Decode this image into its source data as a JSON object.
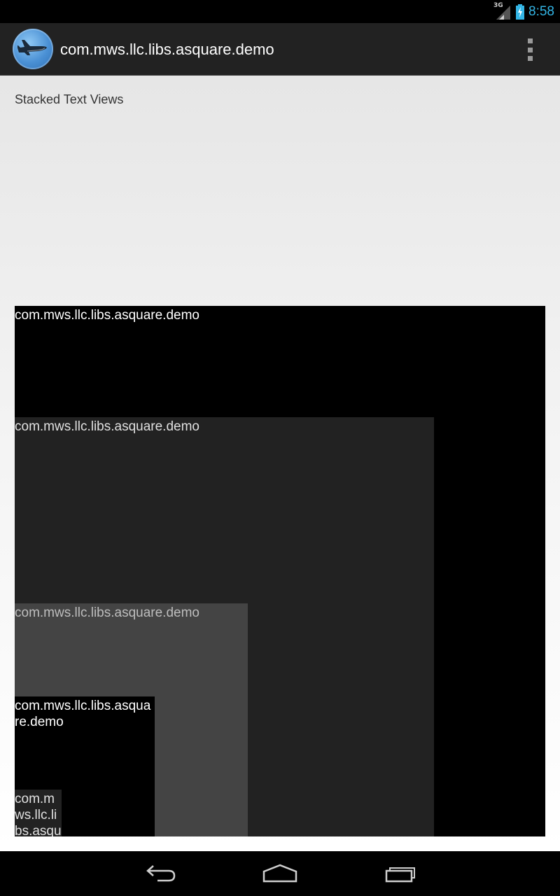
{
  "status_bar": {
    "network": "3G",
    "time": "8:58",
    "icons": [
      "signal-icon",
      "battery-charging-icon"
    ]
  },
  "action_bar": {
    "app_icon": "airplane-icon",
    "title": "com.mws.llc.libs.asquare.demo",
    "overflow_icon": "overflow-menu-icon"
  },
  "content": {
    "section_label": "Stacked Text Views",
    "stacked_views": [
      {
        "text": "com.mws.llc.libs.asquare.demo",
        "background": "#000000",
        "text_color": "#ffffff"
      },
      {
        "text": "com.mws.llc.libs.asquare.demo",
        "background": "#222222",
        "text_color": "#e0e0e0"
      },
      {
        "text": "com.mws.llc.libs.asquare.demo",
        "background": "#444444",
        "text_color": "#bdbdbd"
      },
      {
        "text": "com.mws.llc.libs.asquare.demo",
        "background": "#000000",
        "text_color": "#ffffff"
      },
      {
        "text": "com.mws.llc.libs.asquare.demo",
        "background": "#222222",
        "text_color": "#e0e0e0"
      }
    ]
  },
  "nav_bar": {
    "icons": [
      "back-icon",
      "home-icon",
      "recent-apps-icon"
    ]
  },
  "colors": {
    "clock": "#33b5e5",
    "action_bar": "#222222",
    "content_background": "#eeeeee"
  }
}
